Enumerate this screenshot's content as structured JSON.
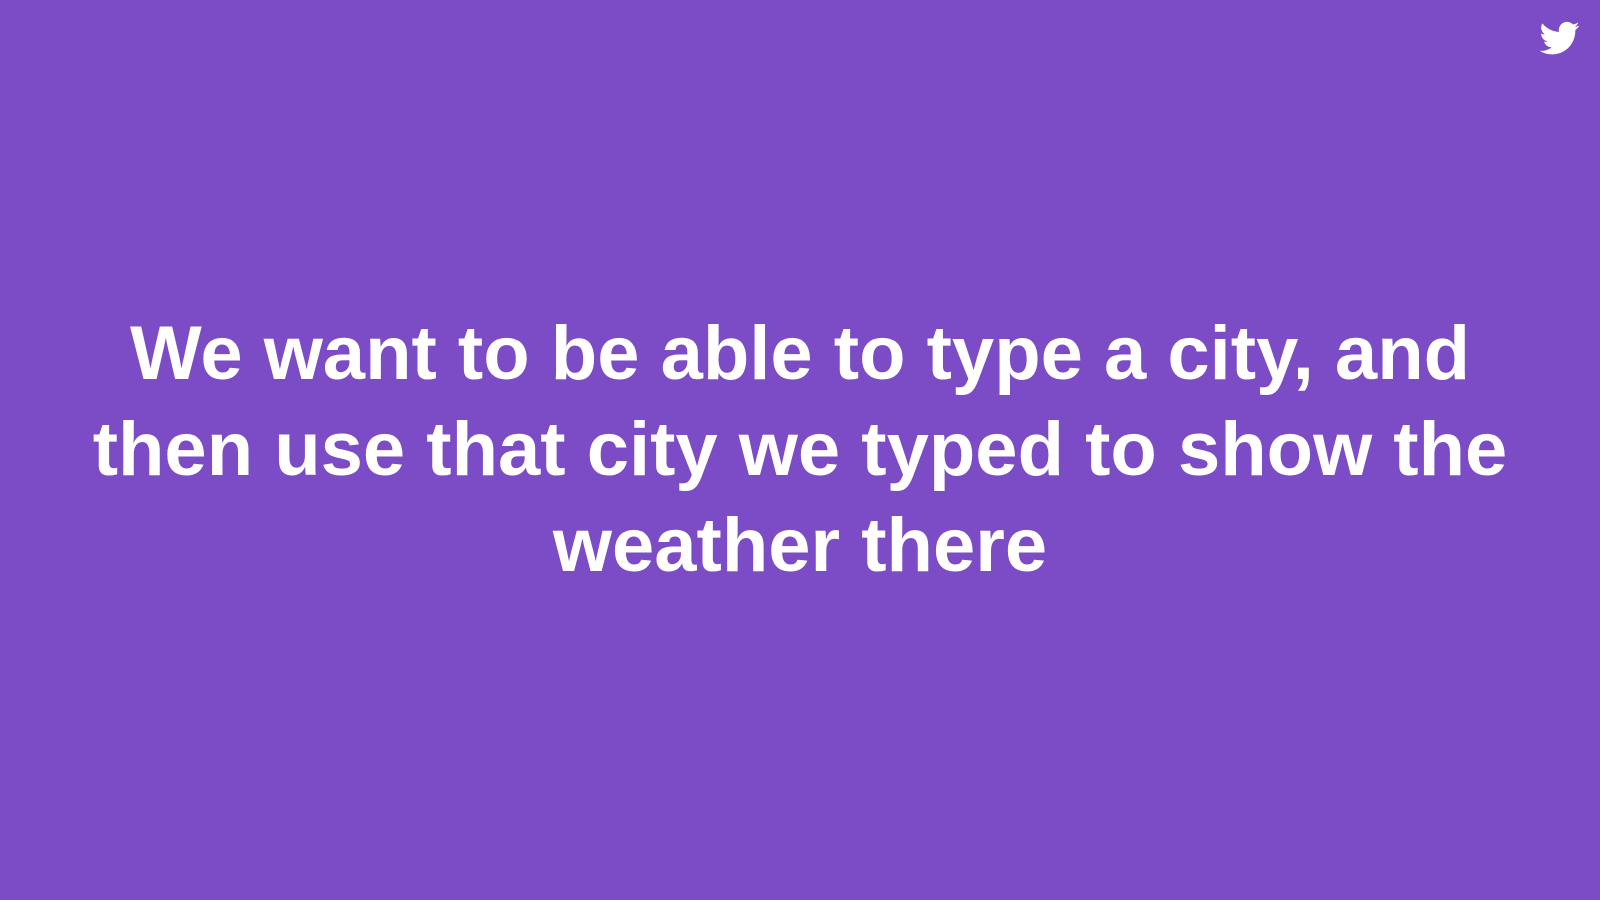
{
  "slide": {
    "background_color": "#7b4cc5",
    "text_color": "#ffffff",
    "icon": "twitter-bird-icon",
    "headline": "We want to be able to type a city, and then use that city we typed to show the weather there"
  }
}
